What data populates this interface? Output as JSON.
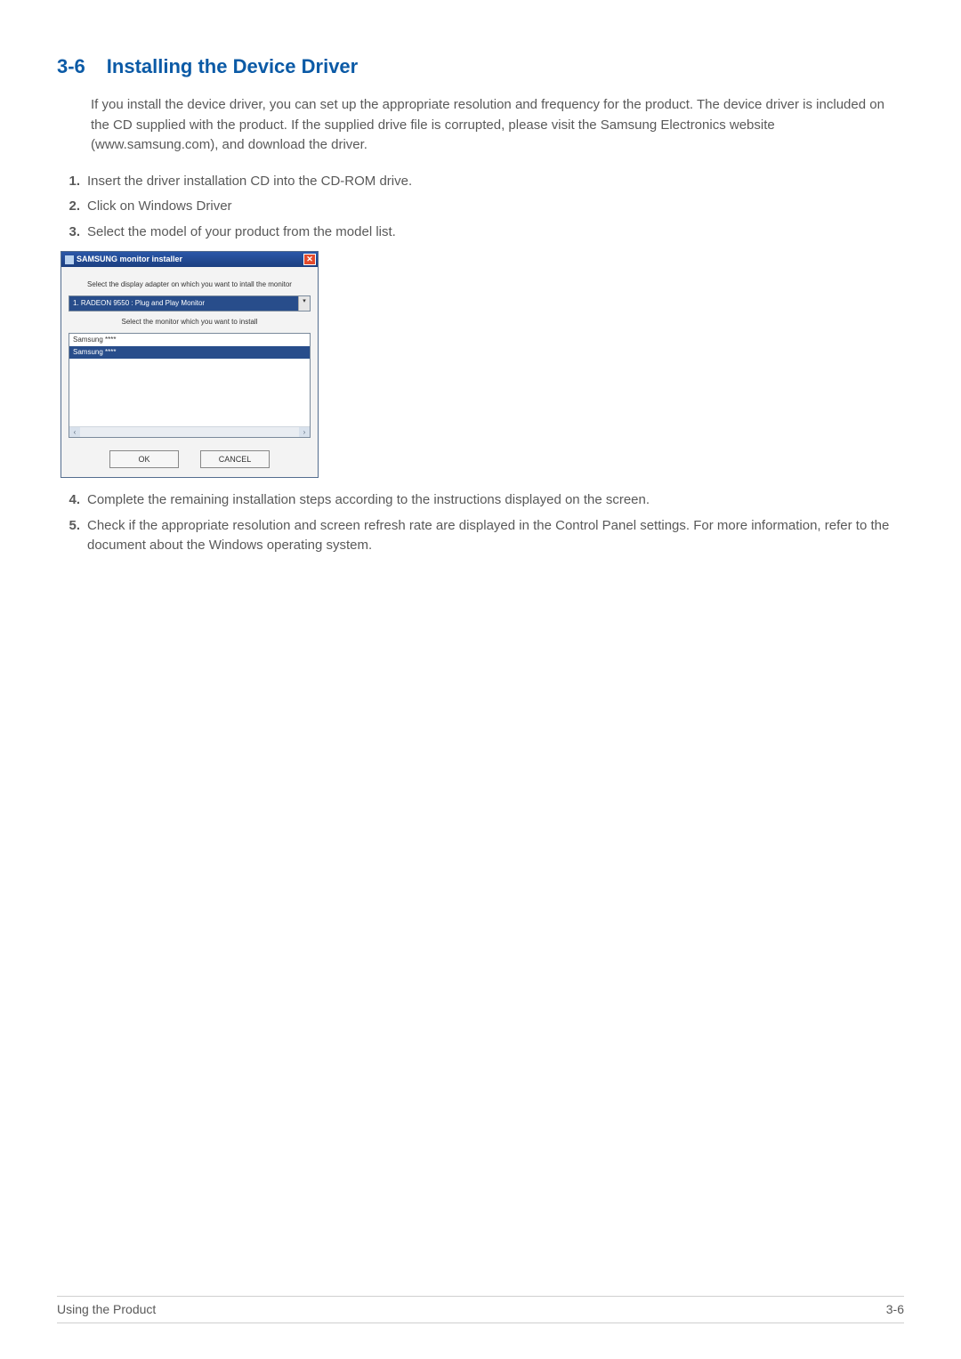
{
  "heading": {
    "number": "3-6",
    "title": "Installing the Device Driver"
  },
  "intro": "If you install the device driver, you can set up the appropriate resolution and frequency for the product. The device driver is included on the CD supplied with the product. If the supplied drive file is corrupted, please visit the Samsung Electronics website (www.samsung.com), and download the driver.",
  "steps": [
    {
      "num": "1.",
      "text": "Insert the driver installation CD into the CD-ROM drive."
    },
    {
      "num": "2.",
      "text": "Click on Windows Driver"
    },
    {
      "num": "3.",
      "text": "Select the model of your product from the model list."
    },
    {
      "num": "4.",
      "text": "Complete the remaining installation steps according to the instructions displayed on the screen."
    },
    {
      "num": "5.",
      "text": "Check if the appropriate resolution and screen refresh rate are displayed in the Control Panel settings. For more information, refer to the document about the Windows operating system."
    }
  ],
  "installer": {
    "title": "SAMSUNG monitor installer",
    "close": "✕",
    "instruction1": "Select the display adapter on which you want to intall the monitor",
    "dropdown_value": "1. RADEON 9550 : Plug and Play Monitor",
    "dropdown_arrow": "▾",
    "instruction2": "Select the monitor which you want to install",
    "list_items": [
      "Samsung ****",
      "Samsung ****"
    ],
    "scroll_left": "‹",
    "scroll_right": "›",
    "ok": "OK",
    "cancel": "CANCEL"
  },
  "footer": {
    "left": "Using the Product",
    "right": "3-6"
  }
}
